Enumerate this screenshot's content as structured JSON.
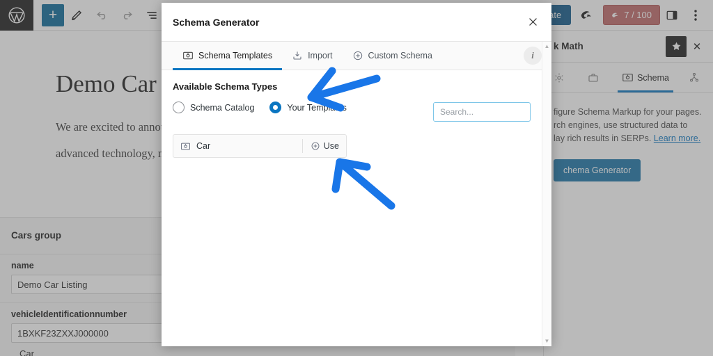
{
  "editor": {
    "toolbar": {
      "wp_logo": "wordpress-logo",
      "add_block_label": "+",
      "icons": [
        "edit-pencil-icon",
        "undo-icon",
        "redo-icon",
        "list-view-icon"
      ],
      "update_label": "Update",
      "seo_score": "7 / 100",
      "rank_math_logo": "rank-math-logo",
      "sidebar_toggle": "settings-sidebar-icon",
      "more_menu": "more-options-icon"
    },
    "post": {
      "title": "Demo Car Listing",
      "paragraph": "We are excited to announce the launch of our latest model. This powerful vehicle is packed with advanced technology, making it the perfect choice for modern drivers."
    },
    "fields": {
      "group_title": "Cars group",
      "rows": [
        {
          "label": "name",
          "value": "Demo Car Listing"
        },
        {
          "label": "vehicleIdentificationnumber",
          "value": "1BXKF23ZXXJ000000"
        }
      ],
      "trailing_label": "Car"
    }
  },
  "sidebar": {
    "title": "k Math",
    "star_icon": "star-icon",
    "close_icon": "close-icon",
    "tabs": [
      {
        "label": "",
        "icon": "gear-icon",
        "active": false
      },
      {
        "label": "",
        "icon": "briefcase-icon",
        "active": false
      },
      {
        "label": "Schema",
        "icon": "schema-icon",
        "active": true
      },
      {
        "label": "",
        "icon": "share-nodes-icon",
        "active": false
      }
    ],
    "description_line1": "figure Schema Markup for your pages.",
    "description_line2": "rch engines, use structured data to",
    "description_line3": "lay rich results in SERPs.",
    "learn_more": "Learn more.",
    "generator_button": "chema Generator"
  },
  "modal": {
    "title": "Schema Generator",
    "close_icon": "close-icon",
    "tabs": [
      {
        "label": "Schema Templates",
        "icon": "schema-icon",
        "active": true
      },
      {
        "label": "Import",
        "icon": "import-icon",
        "active": false
      },
      {
        "label": "Custom Schema",
        "icon": "plus-circle-icon",
        "active": false
      }
    ],
    "info_icon": "info-icon",
    "section_title": "Available Schema Types",
    "radios": [
      {
        "label": "Schema Catalog",
        "selected": false
      },
      {
        "label": "Your Templates",
        "selected": true
      }
    ],
    "search_placeholder": "Search...",
    "templates": [
      {
        "name": "Car",
        "icon": "schema-icon",
        "use_label": "Use",
        "use_icon": "plus-circle-icon"
      }
    ],
    "scrollbar": {
      "up": "▲",
      "down": "▼"
    }
  },
  "annotations": {
    "arrow_1": "arrow-pointing-to-your-templates-radio",
    "arrow_2": "arrow-pointing-to-car-template-row",
    "color": "#1976E8"
  },
  "colors": {
    "accent": "#0b76c1",
    "update_button": "#10598a",
    "seo_badge": "#c06a6a",
    "annotation_blue": "#1976E8"
  }
}
